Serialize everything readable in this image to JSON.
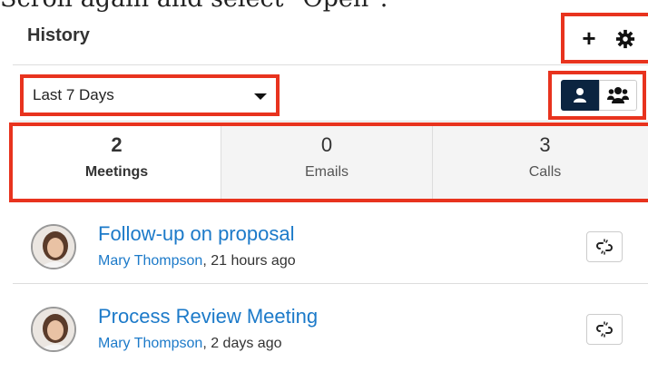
{
  "caption": "Scroll again and select \"Open\".",
  "header": {
    "title": "History",
    "plus_icon": "plus-icon",
    "gear_icon": "gear-icon"
  },
  "filter": {
    "range_value": "Last 7 Days",
    "toggle_user_icon": "user-icon",
    "toggle_team_icon": "team-icon"
  },
  "tabs": [
    {
      "count": "2",
      "label": "Meetings",
      "active": true
    },
    {
      "count": "0",
      "label": "Emails",
      "active": false
    },
    {
      "count": "3",
      "label": "Calls",
      "active": false
    }
  ],
  "items": [
    {
      "subject": "Follow-up on proposal",
      "user": "Mary Thompson",
      "when": ", 21 hours ago"
    },
    {
      "subject": "Process Review Meeting",
      "user": "Mary Thompson",
      "when": ", 2 days ago"
    }
  ],
  "colors": {
    "highlight": "#e8331e",
    "link": "#1c7ac9",
    "toggle_active": "#0b2440"
  }
}
